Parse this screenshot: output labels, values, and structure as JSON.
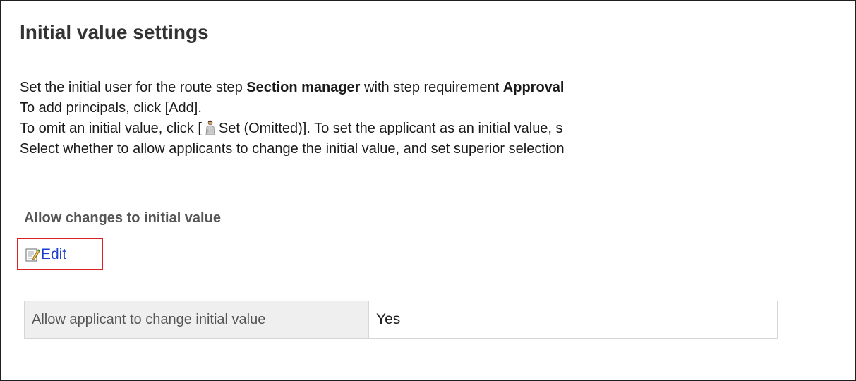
{
  "page": {
    "title": "Initial value settings"
  },
  "description": {
    "line1_prefix": "Set the initial user for the route step ",
    "step_name": "Section manager",
    "line1_middle": " with step requirement ",
    "requirement": "Approval",
    "line2": "To add principals, click [Add].",
    "line3_prefix": "To omit an initial value, click [",
    "line3_icon": "user-omitted-icon",
    "line3_suffix": "Set (Omitted)]. To set the applicant as an initial value, s",
    "line4": "Select whether to allow applicants to change the initial value, and set superior selection"
  },
  "section": {
    "heading": "Allow changes to initial value",
    "edit_label": "Edit",
    "edit_icon": "edit-icon",
    "highlight_color": "#e02020"
  },
  "settings_table": {
    "rows": [
      {
        "label": "Allow applicant to change initial value",
        "value": "Yes"
      }
    ]
  },
  "colors": {
    "link": "#1a3fcf",
    "label_background": "#efefef"
  }
}
